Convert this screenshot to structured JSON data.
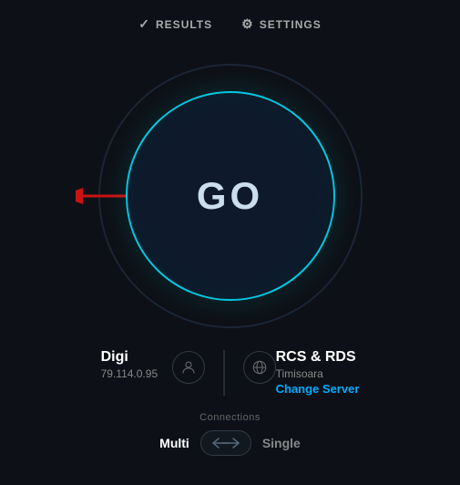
{
  "header": {
    "results_label": "RESULTS",
    "settings_label": "SETTINGS"
  },
  "go_button": {
    "label": "GO"
  },
  "isp_info": {
    "name": "Digi",
    "ip": "79.114.0.95"
  },
  "server_info": {
    "name": "RCS & RDS",
    "location": "Timisoara",
    "change_label": "Change Server"
  },
  "connections": {
    "label": "Connections",
    "multi_label": "Multi",
    "single_label": "Single"
  },
  "colors": {
    "accent_cyan": "#00c8e0",
    "accent_blue": "#00aaff",
    "bg": "#0d1117"
  }
}
